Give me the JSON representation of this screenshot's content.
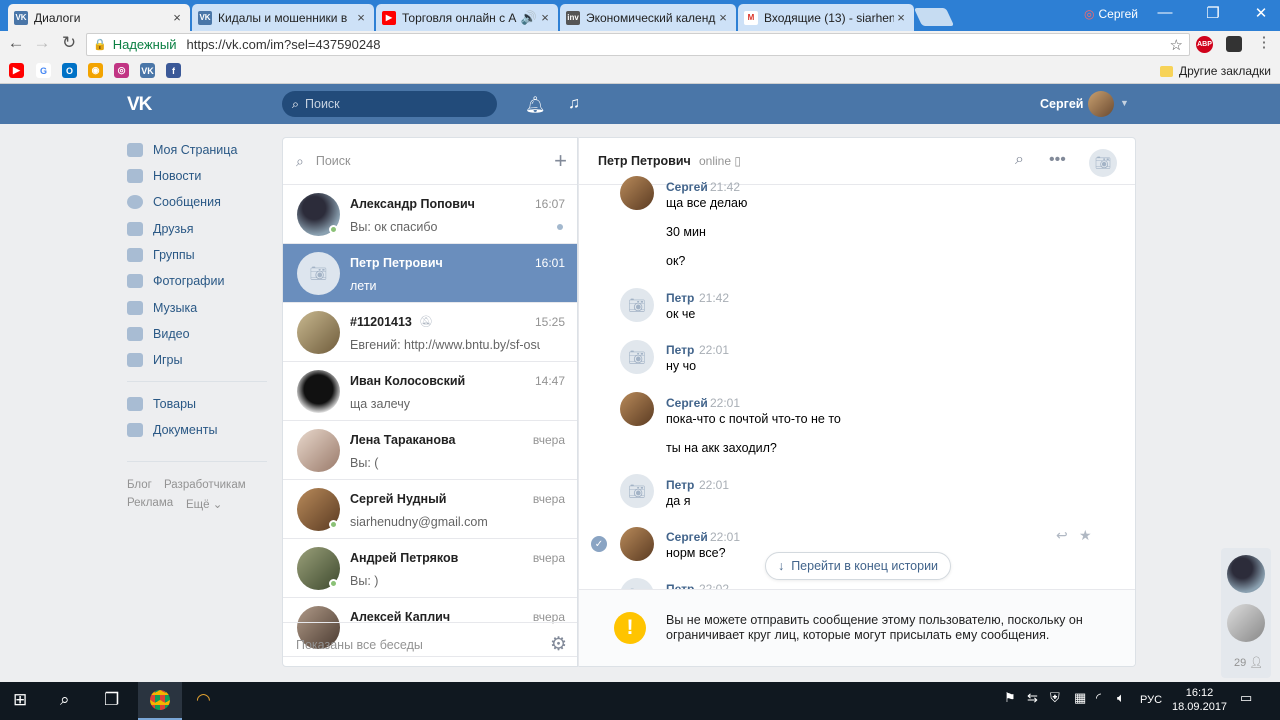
{
  "browser": {
    "tabs": [
      {
        "title": "Диалоги",
        "color": "#4a76a8",
        "glyph": "VK"
      },
      {
        "title": "Кидалы и мошенники в",
        "color": "#4a76a8",
        "glyph": "VK"
      },
      {
        "title": "Торговля онлайн с А",
        "color": "#ff0000",
        "glyph": "▶"
      },
      {
        "title": "Экономический календ",
        "color": "#555555",
        "glyph": "inv"
      },
      {
        "title": "Входящие (13) - siarhen",
        "color": "#d93025",
        "glyph": "M"
      }
    ],
    "profile": "Сергей",
    "secure_label": "Надежный",
    "url": "https://vk.com/im?sel=437590248",
    "other_bookmarks": "Другие закладки"
  },
  "vk": {
    "logo": "VK",
    "search_placeholder": "Поиск",
    "user_name": "Сергей"
  },
  "menu": {
    "items": [
      "Моя Страница",
      "Новости",
      "Сообщения",
      "Друзья",
      "Группы",
      "Фотографии",
      "Музыка",
      "Видео",
      "Игры"
    ],
    "extra": [
      "Товары",
      "Документы"
    ],
    "footer": [
      "Блог",
      "Разработчикам",
      "Реклама",
      "Ещё ⌄"
    ]
  },
  "dialogs": {
    "search_placeholder": "Поиск",
    "list": [
      {
        "name": "Александр Попович",
        "text": "Вы: ок спасибо",
        "time": "16:07"
      },
      {
        "name": "Петр Петрович",
        "text": "лети",
        "time": "16:01"
      },
      {
        "name": "#11201413",
        "text": "Евгений: http://www.bntu.by/sf-osun/it...",
        "time": "15:25"
      },
      {
        "name": "Иван Колосовский",
        "text": "ща залечу",
        "time": "14:47"
      },
      {
        "name": "Лена Тараканова",
        "text": "Вы: (",
        "time": "вчера"
      },
      {
        "name": "Сергей Нудный",
        "text": "siarhenudny@gmail.com",
        "time": "вчера"
      },
      {
        "name": "Андрей Петряков",
        "text": "Вы: )",
        "time": "вчера"
      },
      {
        "name": "Алексей Каплич",
        "text": "",
        "time": "вчера"
      }
    ],
    "footer": "Показаны все беседы"
  },
  "chat": {
    "name": "Петр Петрович",
    "status": "online",
    "messages": [
      {
        "author": "Сергей",
        "time": "21:42",
        "texts": [
          "ща все делаю",
          "30 мин",
          "ок?"
        ]
      },
      {
        "author": "Петр",
        "time": "21:42",
        "texts": [
          "ок че"
        ]
      },
      {
        "author": "Петр",
        "time": "22:01",
        "texts": [
          "ну чо"
        ]
      },
      {
        "author": "Сергей",
        "time": "22:01",
        "texts": [
          "пока-что с почтой что-то не то",
          "ты на акк заходил?"
        ]
      },
      {
        "author": "Петр",
        "time": "22:01",
        "texts": [
          "да я"
        ]
      },
      {
        "author": "Сергей",
        "time": "22:01",
        "texts": [
          "норм все?"
        ]
      },
      {
        "author": "Петр",
        "time": "22:02",
        "texts": []
      }
    ],
    "jump_label": "Перейти в конец истории",
    "warning": "Вы не можете отправить сообщение этому пользователю, поскольку он ограничивает круг лиц, которые могут присылать ему сообщения."
  },
  "friends_strip": {
    "count": "29"
  },
  "taskbar": {
    "lang": "РУС",
    "time": "16:12",
    "date": "18.09.2017"
  }
}
